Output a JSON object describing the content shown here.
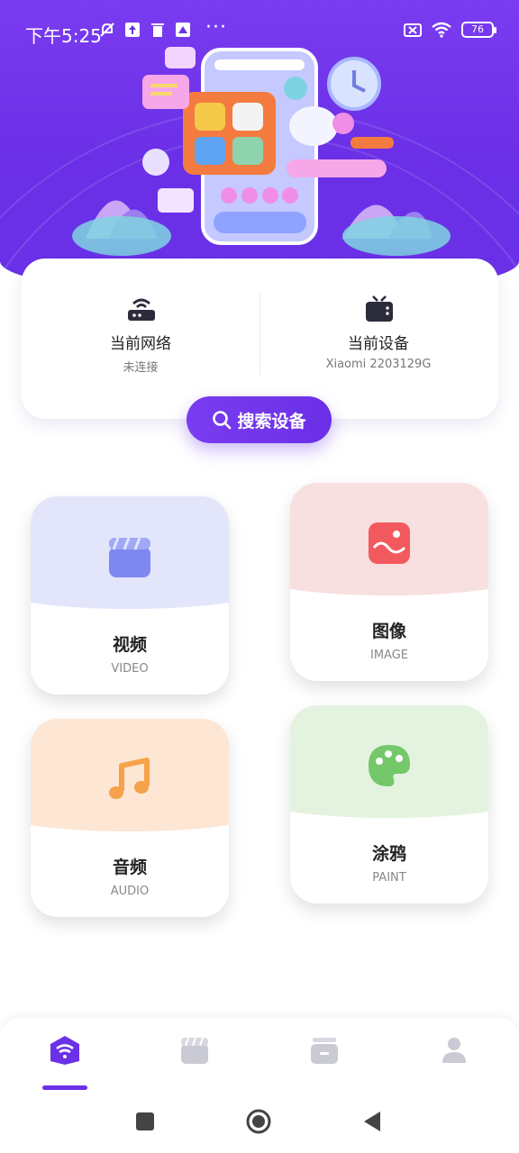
{
  "status_bar": {
    "time": "下午5:25",
    "more": "···",
    "battery": "76"
  },
  "info_card": {
    "network_label": "当前网络",
    "network_value": "未连接",
    "device_label": "当前设备",
    "device_value": "Xiaomi 2203129G"
  },
  "search_button": {
    "label": "搜索设备"
  },
  "features": [
    {
      "title": "视频",
      "subtitle": "VIDEO",
      "color": "#e3e6fb",
      "icon": "video-clapper-icon"
    },
    {
      "title": "图像",
      "subtitle": "IMAGE",
      "color": "#f8dfe0",
      "icon": "image-icon"
    },
    {
      "title": "音频",
      "subtitle": "AUDIO",
      "color": "#fde6d3",
      "icon": "music-note-icon"
    },
    {
      "title": "涂鸦",
      "subtitle": "PAINT",
      "color": "#e4f3e0",
      "icon": "palette-icon"
    }
  ],
  "bottom_nav": {
    "items": [
      "wifi-icon",
      "video-icon",
      "storage-icon",
      "user-icon"
    ],
    "active_index": 0
  },
  "colors": {
    "brand": "#6b31e8",
    "header": "#7a3cf0"
  }
}
